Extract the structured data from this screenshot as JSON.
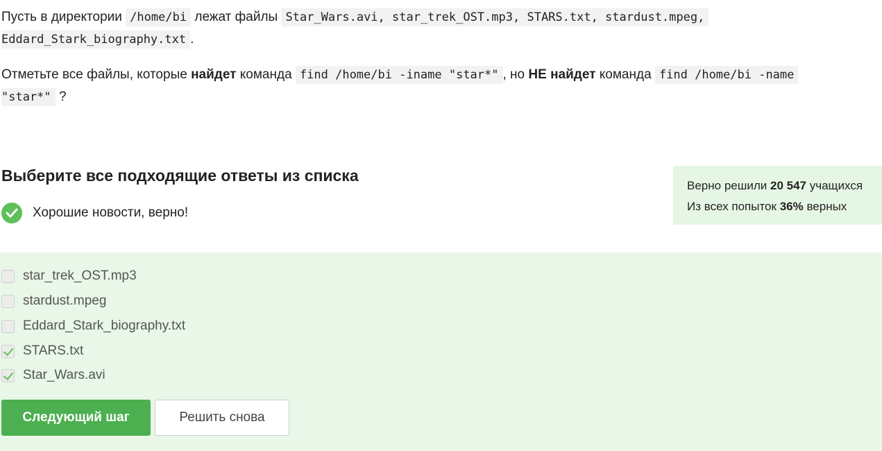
{
  "question": {
    "p1_t1": "Пусть в директории",
    "p1_code1": "/home/bi",
    "p1_t2": "лежат файлы",
    "p1_code2": "Star_Wars.avi, star_trek_OST.mp3, STARS.txt, stardust.mpeg,",
    "p1_code3": "Eddard_Stark_biography.txt",
    "p1_t3": ".",
    "p2_t1": "Отметьте все файлы, которые",
    "p2_b1": "найдет",
    "p2_t2": "команда",
    "p2_code1": "find /home/bi -iname \"star*\"",
    "p2_t3": ", но",
    "p2_b2": "НЕ найдет",
    "p2_t4": "команда",
    "p2_code2": "find /home/bi -name",
    "p2_code3": "\"star*\"",
    "p2_t5": "?"
  },
  "answers_title": "Выберите все подходящие ответы из списка",
  "feedback": {
    "text": "Хорошие новости, верно!",
    "icon": "check-circle-icon",
    "color": "#5fbf5a"
  },
  "stats": {
    "line1_prefix": "Верно решили",
    "line1_count": "20 547",
    "line1_suffix": "учащихся",
    "line2_prefix": "Из всех попыток",
    "line2_percent": "36%",
    "line2_suffix": "верных"
  },
  "options": [
    {
      "label": "star_trek_OST.mp3",
      "checked": false
    },
    {
      "label": "stardust.mpeg",
      "checked": false
    },
    {
      "label": "Eddard_Stark_biography.txt",
      "checked": false
    },
    {
      "label": "STARS.txt",
      "checked": true
    },
    {
      "label": "Star_Wars.avi",
      "checked": true
    }
  ],
  "buttons": {
    "next": "Следующий шаг",
    "retry": "Решить снова"
  },
  "colors": {
    "accent": "#4caf50",
    "answers_bg": "#e8f7e7",
    "stats_bg": "#e6f6e5"
  }
}
